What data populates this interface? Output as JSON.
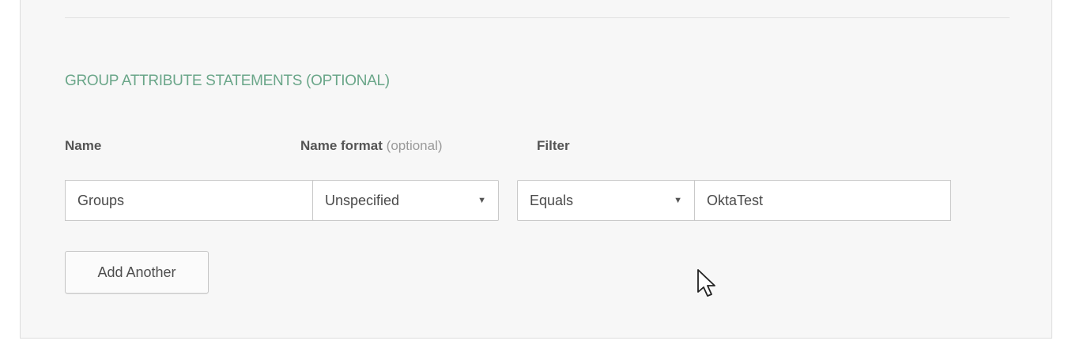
{
  "section": {
    "title": "GROUP ATTRIBUTE STATEMENTS (OPTIONAL)"
  },
  "columns": {
    "name_label": "Name",
    "name_format_label": "Name format",
    "name_format_optional": "(optional)",
    "filter_label": "Filter"
  },
  "row": {
    "name_value": "Groups",
    "name_format_value": "Unspecified",
    "filter_type_value": "Equals",
    "filter_value": "OktaTest"
  },
  "actions": {
    "add_another_label": "Add Another"
  },
  "colors": {
    "section_title": "#6aa689",
    "panel_background": "#f7f7f7"
  },
  "icons": {
    "dropdown": "caret-down-icon",
    "cursor": "mouse-pointer-icon"
  }
}
